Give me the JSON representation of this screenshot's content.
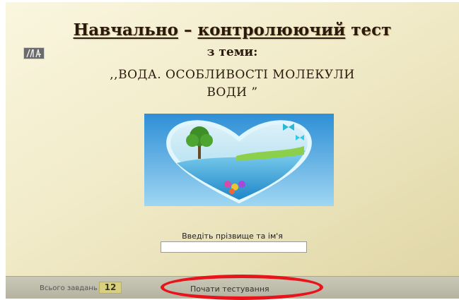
{
  "title": {
    "part1": "Навчально",
    "dash": " – ",
    "part2": "контролюючий",
    "part3": " тест"
  },
  "subtitle": "з теми:",
  "topic": {
    "line1": ",,ВОДА. ОСОБЛИВОСТІ МОЛЕКУЛИ",
    "line2": "ВОДИ ”"
  },
  "form": {
    "name_label": "Введіть прізвище та ім'я",
    "name_value": ""
  },
  "footer": {
    "total_label": "Всього завдань",
    "total_value": "12",
    "start_label": "Почати тестування"
  },
  "colors": {
    "highlight": "#e8141b",
    "counter_bg": "#d8d07f"
  },
  "icons": {
    "logo": "logo-icon",
    "illustration": "water-heart-illustration"
  }
}
